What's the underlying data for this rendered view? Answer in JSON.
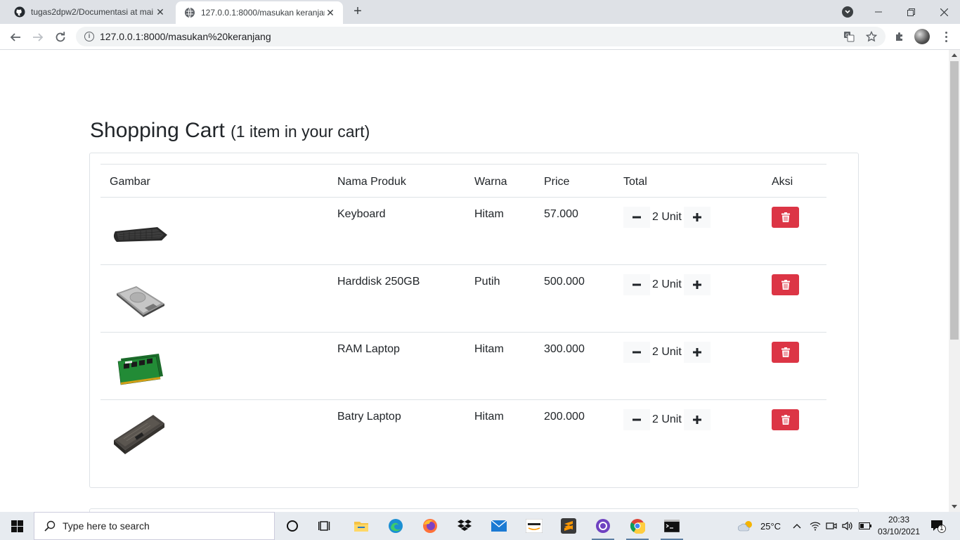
{
  "browser": {
    "tabs": [
      {
        "title": "tugas2dpw2/Documentasi at mai",
        "active": false
      },
      {
        "title": "127.0.0.1:8000/masukan keranjan",
        "active": true
      }
    ],
    "url": "127.0.0.1:8000/masukan%20keranjang"
  },
  "page": {
    "title": "Shopping Cart",
    "subtitle": "(1 item in your cart)",
    "columns": [
      "Gambar",
      "Nama Produk",
      "Warna",
      "Price",
      "Total",
      "Aksi"
    ],
    "unit_suffix": "Unit",
    "items": [
      {
        "name": "Keyboard",
        "color": "Hitam",
        "price": "57.000",
        "qty": "2 Unit",
        "image": "keyboard"
      },
      {
        "name": "Harddisk 250GB",
        "color": "Putih",
        "price": "500.000",
        "qty": "2 Unit",
        "image": "harddisk"
      },
      {
        "name": "RAM Laptop",
        "color": "Hitam",
        "price": "300.000",
        "qty": "2 Unit",
        "image": "ram"
      },
      {
        "name": "Batry Laptop",
        "color": "Hitam",
        "price": "200.000",
        "qty": "2 Unit",
        "image": "battery"
      }
    ]
  },
  "taskbar": {
    "search_placeholder": "Type here to search",
    "weather": "25°C",
    "time": "20:33",
    "date": "03/10/2021",
    "notifications": "1"
  },
  "colors": {
    "danger": "#dc3545",
    "border": "#dee2e6",
    "qty_bg": "#f8f9fa"
  }
}
